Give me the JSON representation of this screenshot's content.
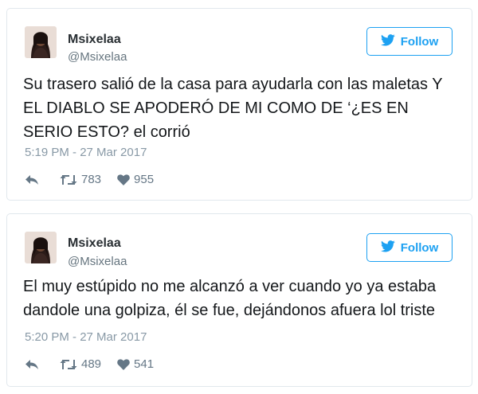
{
  "tweets": [
    {
      "display_name": "Msixelaa",
      "handle": "@Msixelaa",
      "follow_label": "Follow",
      "text": "Su trasero salió de la casa para ayudarla con las maletas Y EL DIABLO SE APODERÓ DE MI COMO DE ‘¿ES EN SERIO ESTO? el corrió",
      "timestamp": "5:19 PM - 27 Mar 2017",
      "retweets": "783",
      "likes": "955"
    },
    {
      "display_name": "Msixelaa",
      "handle": "@Msixelaa",
      "follow_label": "Follow",
      "text": "El muy estúpido no me alcanzó a ver cuando yo ya estaba dandole una golpiza, él se fue, dejándonos afuera lol triste",
      "timestamp": "5:20 PM - 27 Mar 2017",
      "retweets": "489",
      "likes": "541"
    }
  ],
  "icons": {
    "follow": "bird-icon",
    "reply": "reply-icon",
    "retweet": "retweet-icon",
    "like": "heart-icon"
  },
  "colors": {
    "accent": "#1da1f2",
    "muted": "#8899a6",
    "border": "#e1e8ed"
  }
}
